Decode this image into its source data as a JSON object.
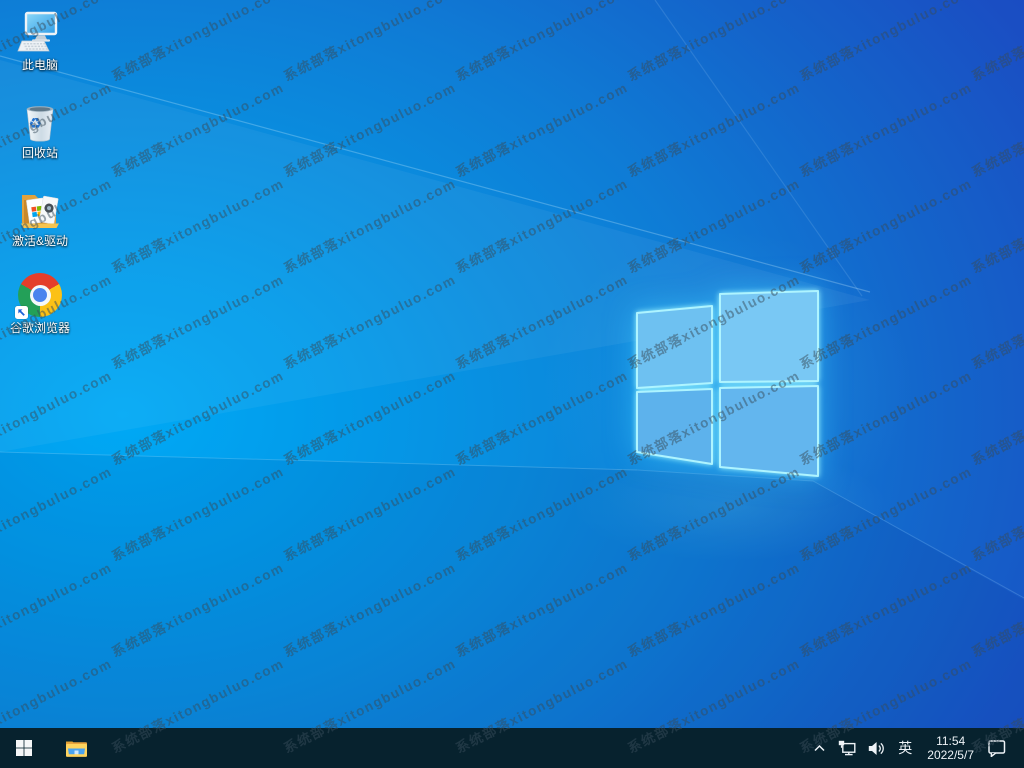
{
  "desktop": {
    "watermark_text": "系统部落xitongbuluo.com",
    "icons": [
      {
        "name": "this-pc",
        "label": "此电脑"
      },
      {
        "name": "recycle-bin",
        "label": "回收站"
      },
      {
        "name": "activation-driver",
        "label": "激活&驱动"
      },
      {
        "name": "google-chrome",
        "label": "谷歌浏览器"
      }
    ],
    "wallpaper": "windows-10-light-logo"
  },
  "taskbar": {
    "buttons": [
      {
        "name": "start",
        "icon": "windows-logo-icon"
      },
      {
        "name": "file-explorer",
        "icon": "folder-icon"
      }
    ],
    "tray": {
      "hidden_icons_icon": "chevron-up-icon",
      "network_icon": "ethernet-icon",
      "volume_icon": "speaker-icon",
      "ime": "英",
      "time": "11:54",
      "date": "2022/5/7",
      "action_center_icon": "speech-bubble-icon"
    }
  },
  "colors": {
    "taskbar_bg": "#07222e",
    "wallpaper_bright": "#00a9f5",
    "wallpaper_deep": "#1b46c0",
    "logo_glow": "#aef4ff",
    "watermark_color": "rgba(55,75,90,0.5)",
    "chrome_red": "#e43e2b",
    "chrome_yellow": "#fbc116",
    "chrome_green": "#23a058",
    "chrome_blue": "#4a84ee"
  }
}
